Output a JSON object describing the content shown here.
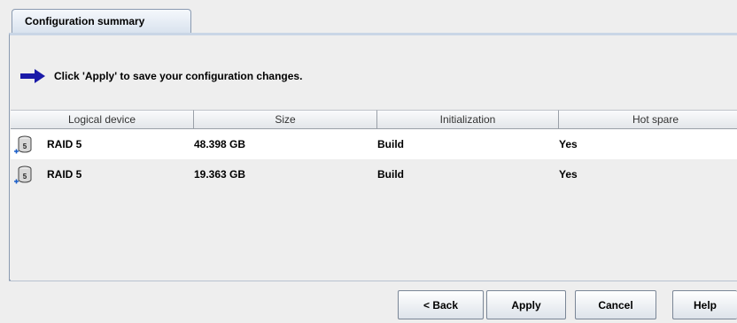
{
  "tab": {
    "label": "Configuration summary"
  },
  "message": {
    "text": "Click 'Apply' to save your configuration changes.",
    "icon": "arrow-right-icon"
  },
  "table": {
    "columns": [
      "Logical device",
      "Size",
      "Initialization",
      "Hot spare"
    ],
    "rows": [
      {
        "device": "RAID 5",
        "size": "48.398 GB",
        "init": "Build",
        "hot_spare": "Yes",
        "icon": "raid5-disk-icon"
      },
      {
        "device": "RAID 5",
        "size": "19.363 GB",
        "init": "Build",
        "hot_spare": "Yes",
        "icon": "raid5-disk-icon"
      }
    ]
  },
  "buttons": {
    "back": "< Back",
    "apply": "Apply",
    "cancel": "Cancel",
    "help": "Help"
  },
  "colors": {
    "arrow": "#1a1aa8",
    "accent": "#c9d6e6"
  }
}
